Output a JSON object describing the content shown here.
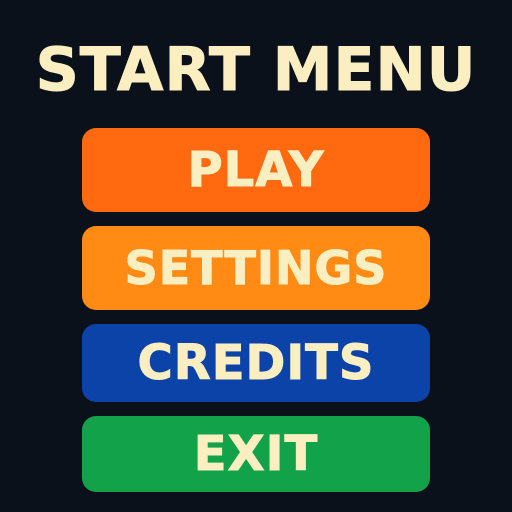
{
  "title": "START MENU",
  "colors": {
    "background": "#0b111a",
    "text": "#fbefc2",
    "play": "#ff6a10",
    "settings": "#ff8a14",
    "credits": "#0b43a8",
    "exit": "#12a24a"
  },
  "menu": {
    "play_label": "PLAY",
    "settings_label": "SETTINGS",
    "credits_label": "CREDITS",
    "exit_label": "EXIT"
  }
}
